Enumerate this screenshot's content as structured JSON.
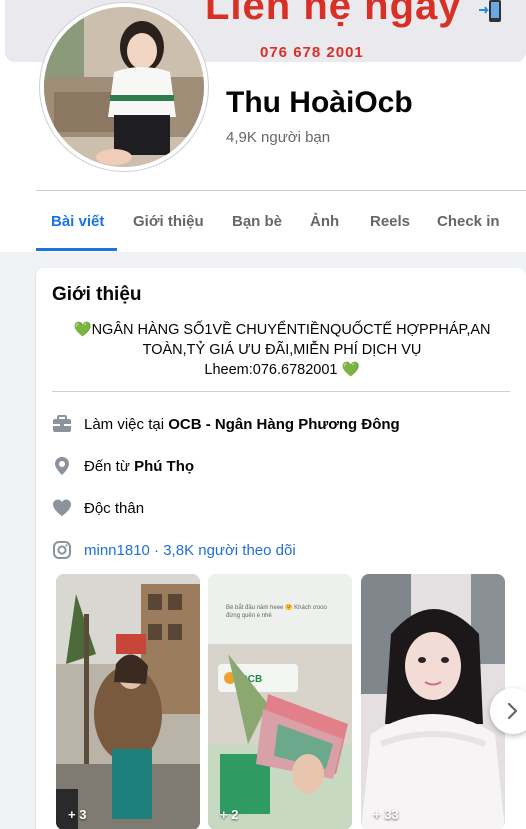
{
  "cover": {
    "banner_text": "Liên hệ ngay",
    "phone_text": "076 678 2001"
  },
  "profile": {
    "name": "Thu HoàiOcb",
    "friends": "4,9K người bạn"
  },
  "tabs": [
    {
      "label": "Bài viết",
      "active": true
    },
    {
      "label": "Giới thiệu",
      "active": false
    },
    {
      "label": "Bạn bè",
      "active": false
    },
    {
      "label": "Ảnh",
      "active": false
    },
    {
      "label": "Reels",
      "active": false
    },
    {
      "label": "Check in",
      "active": false
    }
  ],
  "intro": {
    "title": "Giới thiệu",
    "bio_line1": "NGÂN HÀNG SỐ1VỀ CHUYỂNTIỀNQUỐCTẾ HỢPPHÁP,AN",
    "bio_line2": "TOÀN,TỶ GIÁ ƯU ĐÃI,MIỄN PHÍ DỊCH VỤ",
    "bio_line3": "Lheem:076.6782001",
    "heart_emoji": "💚",
    "work_prefix": "Làm việc tại ",
    "work_org": "OCB - Ngân Hàng Phương Đông",
    "from_prefix": "Đến từ ",
    "from_place": "Phú Thọ",
    "relationship": "Độc thân",
    "instagram": "minn1810 · 3,8K người theo dõi"
  },
  "photos": [
    {
      "count": "+ 3"
    },
    {
      "count": "+ 2",
      "caption": "Bé bắt đầu nàm heee 🤗 Khách ơooo đừng quên e nhé"
    },
    {
      "count": "+ 33"
    }
  ],
  "colors": {
    "accent": "#1b74e4",
    "link": "#216fdb",
    "muted": "#65676b",
    "heart": "#34c38f"
  },
  "icons": [
    "briefcase-icon",
    "location-pin-icon",
    "heart-icon",
    "instagram-icon",
    "chevron-right-icon"
  ]
}
